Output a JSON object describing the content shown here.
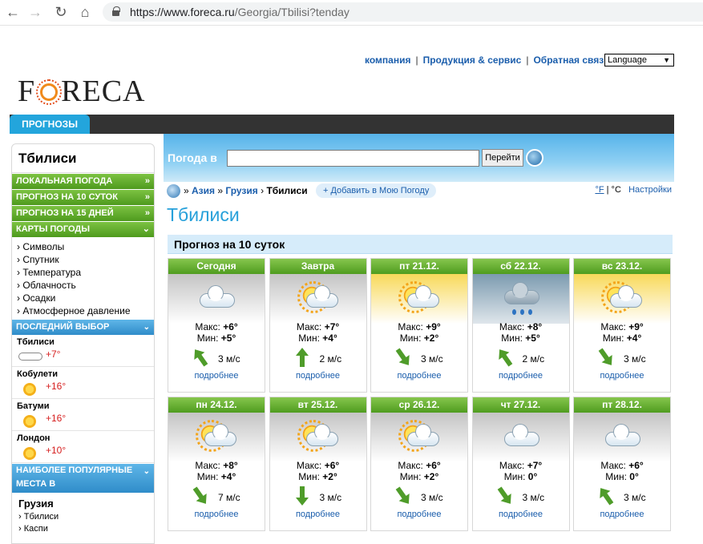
{
  "browser": {
    "url_host": "https://www.foreca.ru",
    "url_path": "/Georgia/Tbilisi?tenday"
  },
  "toplinks": {
    "company": "компания",
    "products": "Продукция & сервис",
    "feedback": "Обратная связь",
    "language": "Language"
  },
  "logo": {
    "left": "F",
    "right": "RECA"
  },
  "nav": {
    "forecasts_tab": "ПРОГНОЗЫ"
  },
  "sidebar": {
    "city": "Тбилиси",
    "menu": [
      "ЛОКАЛЬНАЯ ПОГОДА",
      "ПРОГНОЗ НА 10 СУТОК",
      "ПРОГНОЗ НА 15 ДНЕЙ",
      "КАРТЫ ПОГОДЫ"
    ],
    "menu_chevrons": [
      "»",
      "»",
      "»",
      "»"
    ],
    "map_items": [
      "Символы",
      "Спутник",
      "Температура",
      "Облачность",
      "Осадки",
      "Атмосферное давление"
    ],
    "recent_header": "ПОСЛЕДНИЙ ВЫБОР",
    "recent": [
      {
        "name": "Тбилиси",
        "temp": "+7°",
        "icon": "cloud-icon"
      },
      {
        "name": "Кобулети",
        "temp": "+16°",
        "icon": "sun-icon"
      },
      {
        "name": "Батуми",
        "temp": "+16°",
        "icon": "sun-icon"
      },
      {
        "name": "Лондон",
        "temp": "+10°",
        "icon": "sun-icon"
      }
    ],
    "popular_header": "НАИБОЛЕЕ ПОПУЛЯРНЫЕ МЕСТА В",
    "country": "Грузия",
    "popular": [
      "Тбилиси",
      "Каспи"
    ]
  },
  "search": {
    "label": "Погода в",
    "value": "",
    "go": "Перейти"
  },
  "breadcrumb": {
    "asia": "Азия",
    "georgia": "Грузия",
    "city": "Тбилиси",
    "add": "+ Добавить в Мою Погоду",
    "unit_f": "°F",
    "unit_c": "°C",
    "settings": "Настройки"
  },
  "title": "Тбилиси",
  "section_title": "Прогноз на 10 суток",
  "labels": {
    "max": "Макс:",
    "min": "Мин:",
    "more": "подробнее"
  },
  "days": [
    {
      "day": "Сегодня",
      "max": "+6°",
      "min": "+5°",
      "wind": "3 м/с",
      "sky": "cloud",
      "icon": "cloudy-icon",
      "arrow": "arrow-up-left"
    },
    {
      "day": "Завтра",
      "max": "+7°",
      "min": "+4°",
      "wind": "2 м/с",
      "sky": "cloud",
      "icon": "partly-cloudy-icon",
      "arrow": "arrow-up"
    },
    {
      "day": "пт 21.12.",
      "max": "+9°",
      "min": "+2°",
      "wind": "3 м/с",
      "sky": "sunny",
      "icon": "partly-cloudy-icon",
      "arrow": "arrow-down-right"
    },
    {
      "day": "сб 22.12.",
      "max": "+8°",
      "min": "+5°",
      "wind": "2 м/с",
      "sky": "rain",
      "icon": "rain-icon",
      "arrow": "arrow-up-left"
    },
    {
      "day": "вс 23.12.",
      "max": "+9°",
      "min": "+4°",
      "wind": "3 м/с",
      "sky": "sunny",
      "icon": "partly-cloudy-icon",
      "arrow": "arrow-down-right"
    },
    {
      "day": "пн 24.12.",
      "max": "+8°",
      "min": "+4°",
      "wind": "7 м/с",
      "sky": "cloud",
      "icon": "partly-cloudy-icon",
      "arrow": "arrow-down-right"
    },
    {
      "day": "вт 25.12.",
      "max": "+6°",
      "min": "+2°",
      "wind": "3 м/с",
      "sky": "cloud",
      "icon": "partly-cloudy-icon",
      "arrow": "arrow-down"
    },
    {
      "day": "ср 26.12.",
      "max": "+6°",
      "min": "+2°",
      "wind": "3 м/с",
      "sky": "cloud",
      "icon": "partly-cloudy-icon",
      "arrow": "arrow-down-right"
    },
    {
      "day": "чт 27.12.",
      "max": "+7°",
      "min": "0°",
      "wind": "3 м/с",
      "sky": "cloud",
      "icon": "cloudy-icon",
      "arrow": "arrow-down-right"
    },
    {
      "day": "пт 28.12.",
      "max": "+6°",
      "min": "0°",
      "wind": "3 м/с",
      "sky": "cloud",
      "icon": "cloudy-icon",
      "arrow": "arrow-up-left"
    }
  ],
  "colors": {
    "link": "#1b5eac",
    "green": "#4e9a1d",
    "blue": "#2f8cc9",
    "title": "#26a0da",
    "hot": "#d61e1e"
  }
}
